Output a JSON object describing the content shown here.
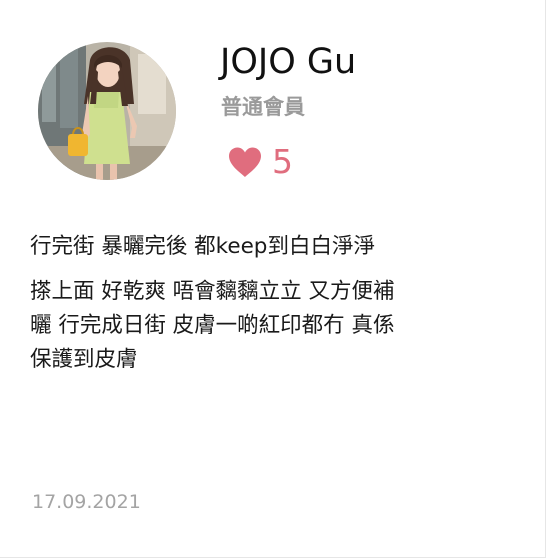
{
  "review": {
    "user": {
      "name": "JOJO Gu",
      "tier": "普通會員",
      "avatar_icon": "user-photo-avatar"
    },
    "likes": {
      "count": "5",
      "icon": "heart-icon",
      "color": "#e06d7e"
    },
    "body_lines": [
      "行完街 暴曬完後 都keep到白白淨淨",
      "搽上面 好乾爽 唔會黐黐立立 又方便補",
      "曬 行完成日街 皮膚一啲紅印都冇 真係",
      "保護到皮膚"
    ],
    "date": "17.09.2021"
  }
}
